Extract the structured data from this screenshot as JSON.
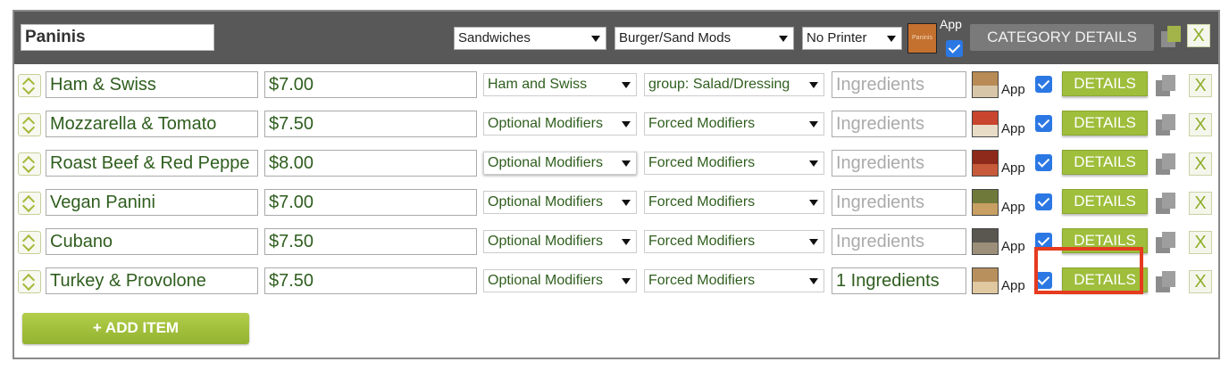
{
  "header": {
    "category_name": "Paninis",
    "group_select": "Sandwiches",
    "modifier_select": "Burger/Sand Mods",
    "printer_select": "No Printer",
    "thumb_text": "Paninis",
    "app_label": "App",
    "app_checked": true,
    "category_details_label": "CATEGORY DETAILS",
    "delete_label": "X"
  },
  "items": [
    {
      "name": "Ham & Swiss",
      "price": "$7.00",
      "optional_modifiers": "Ham and Swiss",
      "forced_modifiers": "group: Salad/Dressing",
      "ingredients": "Ingredients",
      "ingredients_is_placeholder": true,
      "app_label": "App",
      "app_checked": true,
      "details_label": "DETAILS",
      "delete_label": "X",
      "thumb_colors": [
        "#b88a55",
        "#d8c6a8"
      ]
    },
    {
      "name": "Mozzarella & Tomato",
      "price": "$7.50",
      "optional_modifiers": "Optional Modifiers",
      "forced_modifiers": "Forced Modifiers",
      "ingredients": "Ingredients",
      "ingredients_is_placeholder": true,
      "app_label": "App",
      "app_checked": true,
      "details_label": "DETAILS",
      "delete_label": "X",
      "thumb_colors": [
        "#c9452e",
        "#e8dcc6"
      ]
    },
    {
      "name": "Roast Beef & Red Peppe",
      "price": "$8.00",
      "optional_modifiers": "Optional Modifiers",
      "forced_modifiers": "Forced Modifiers",
      "ingredients": "Ingredients",
      "ingredients_is_placeholder": true,
      "app_label": "App",
      "app_checked": true,
      "details_label": "DETAILS",
      "delete_label": "X",
      "thumb_colors": [
        "#8e2a1c",
        "#c65a3a"
      ]
    },
    {
      "name": "Vegan Panini",
      "price": "$7.00",
      "optional_modifiers": "Optional Modifiers",
      "forced_modifiers": "Forced Modifiers",
      "ingredients": "Ingredients",
      "ingredients_is_placeholder": true,
      "app_label": "App",
      "app_checked": true,
      "details_label": "DETAILS",
      "delete_label": "X",
      "thumb_colors": [
        "#6f7a3a",
        "#c9a063"
      ]
    },
    {
      "name": "Cubano",
      "price": "$7.50",
      "optional_modifiers": "Optional Modifiers",
      "forced_modifiers": "Forced Modifiers",
      "ingredients": "Ingredients",
      "ingredients_is_placeholder": true,
      "app_label": "App",
      "app_checked": true,
      "details_label": "DETAILS",
      "delete_label": "X",
      "thumb_colors": [
        "#5a5650",
        "#9b8f7a"
      ]
    },
    {
      "name": "Turkey & Provolone",
      "price": "$7.50",
      "optional_modifiers": "Optional Modifiers",
      "forced_modifiers": "Forced Modifiers",
      "ingredients": "1 Ingredients",
      "ingredients_is_placeholder": false,
      "app_label": "App",
      "app_checked": true,
      "details_label": "DETAILS",
      "delete_label": "X",
      "thumb_colors": [
        "#b8905e",
        "#e0c8a0"
      ]
    }
  ],
  "add_item_label": "+ ADD ITEM",
  "colors": {
    "header_bg": "#585858",
    "accent_green": "#9fbe3c",
    "text_green": "#2f5e1e",
    "highlight_red": "#e53b1f",
    "checkbox_blue": "#2b78e4"
  }
}
